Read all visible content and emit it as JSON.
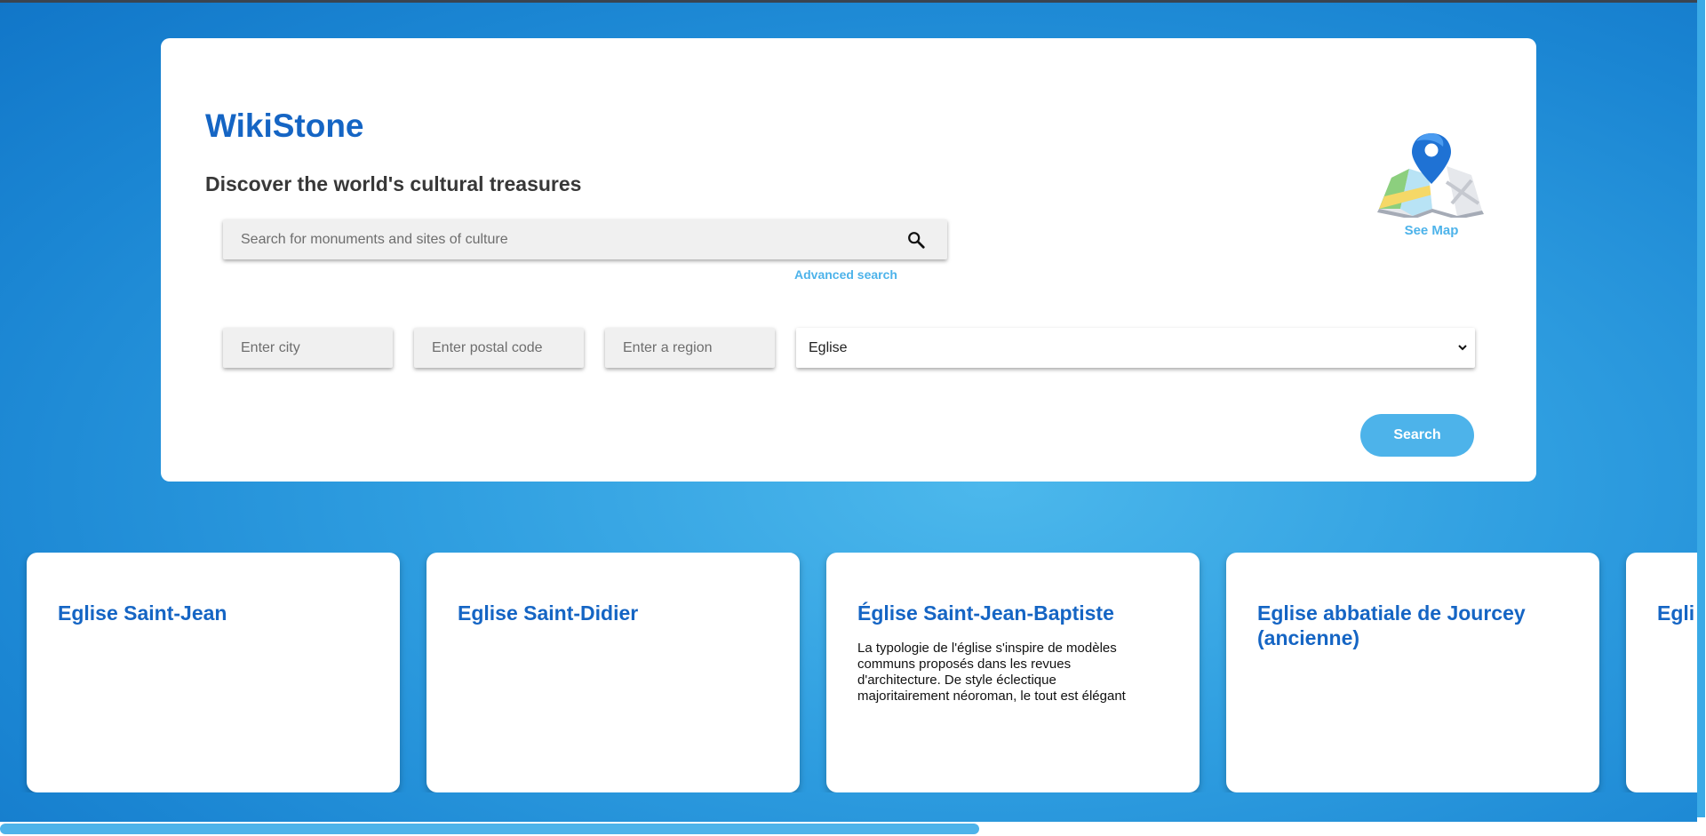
{
  "header": {
    "title": "WikiStone",
    "tagline": "Discover the world's cultural treasures"
  },
  "search": {
    "placeholder": "Search for monuments and sites of culture",
    "advanced_label": "Advanced search",
    "icon": "search-icon"
  },
  "map": {
    "label": "See Map",
    "icon": "map-pin-icon"
  },
  "filters": {
    "city_placeholder": "Enter city",
    "postal_placeholder": "Enter postal code",
    "region_placeholder": "Enter a region",
    "type_selected": "Eglise"
  },
  "search_button_label": "Search",
  "cards": [
    {
      "title": "Eglise Saint-Jean",
      "description": ""
    },
    {
      "title": "Eglise Saint-Didier",
      "description": ""
    },
    {
      "title": "Église Saint-Jean-Baptiste",
      "description": "La typologie de l'église s'inspire de modèles communs proposés dans les revues d'architecture. De style éclectique majoritairement néoroman, le tout est élégant mais très simple. Le plan rectangulaire est orienté nord-sud. La polychromie de"
    },
    {
      "title": "Eglise abbatiale de Jourcey (ancienne)",
      "description": ""
    },
    {
      "title": "Egli",
      "description": ""
    }
  ],
  "colors": {
    "accent": "#4db3ea",
    "title_blue": "#1565c4",
    "background": "#2f9ee0"
  }
}
